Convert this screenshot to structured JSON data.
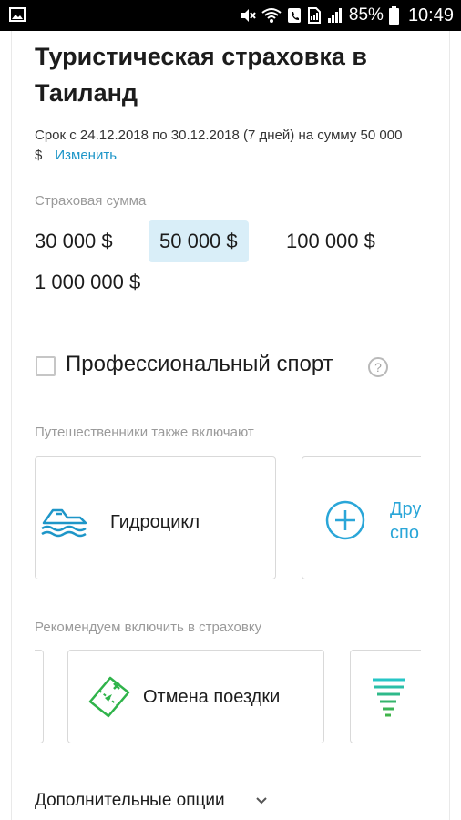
{
  "status_bar": {
    "battery_percent": "85%",
    "time": "10:49",
    "icons": [
      "image-icon",
      "mute-icon",
      "wifi-icon",
      "call-icon",
      "sim-icon",
      "signal-icon",
      "battery-icon"
    ]
  },
  "page": {
    "title": "Туристическая страховка в Таиланд",
    "period_text": "Срок с 24.12.2018 по 30.12.2018 (7 дней) на сумму 50 000 $",
    "change_link": "Изменить"
  },
  "insurance_sum": {
    "label": "Страховая сумма",
    "options": [
      "30 000 $",
      "50 000 $",
      "100 000 $",
      "1 000 000 $"
    ],
    "selected": "50 000 $"
  },
  "pro_sport": {
    "label": "Профессиональный спорт",
    "checked": false,
    "help_glyph": "?"
  },
  "travelers_include": {
    "label": "Путешественники также включают",
    "tiles": [
      {
        "icon": "jet-ski-icon",
        "label": "Гидроцикл"
      },
      {
        "icon": "plus-circle-icon",
        "label_line1": "Дру",
        "label_line2": "спо"
      }
    ]
  },
  "recommended": {
    "label": "Рекомендуем включить в страховку",
    "tiles": [
      {
        "icon": "ticket-cancel-icon",
        "label": "Отмена поездки"
      },
      {
        "icon": "tornado-icon",
        "label": ""
      }
    ]
  },
  "additional_options": {
    "label": "Дополнительные опции"
  },
  "colors": {
    "accent_blue": "#1e96c8",
    "selected_bg": "#d9eef8",
    "green_icon": "#2fb34a"
  }
}
